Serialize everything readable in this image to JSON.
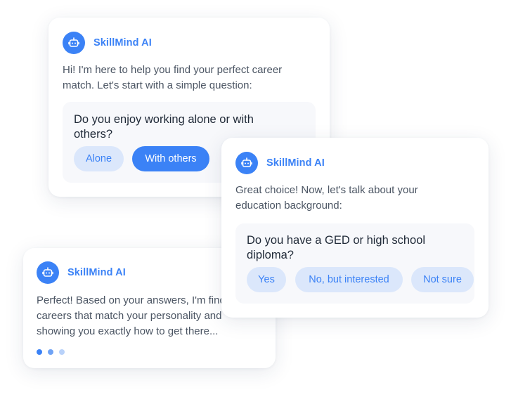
{
  "colors": {
    "accent": "#3b82f6",
    "option_bg": "#dbe7fb",
    "question_bg": "#f7f8fb"
  },
  "card_education": {
    "bot_name": "SkillMind AI",
    "avatar_icon": "robot-icon",
    "message_line1": "Great choice! Now, let's talk about your",
    "message_line2": "education background:",
    "question_line1": "Do you have a GED or high school",
    "question_line2": "diploma?",
    "options": [
      "Yes",
      "No, but interested",
      "Not sure"
    ]
  },
  "card_work_style": {
    "bot_name": "SkillMind AI",
    "avatar_icon": "robot-icon",
    "message_line1": "Hi! I'm here to help you find your perfect career",
    "message_line2": "match. Let's start with a simple question:",
    "question_line1": "Do you enjoy working alone or with",
    "question_line2": "others?",
    "options": [
      "Alone",
      "With others"
    ],
    "selected_option": "With others"
  },
  "card_result": {
    "bot_name": "SkillMind AI",
    "avatar_icon": "robot-icon",
    "message_line1": "Perfect! Based on your answers, I'm finding",
    "message_line2": "careers that match your personality and",
    "message_line3": "showing you exactly how to get there...",
    "typing_indicator_dots": 3
  }
}
